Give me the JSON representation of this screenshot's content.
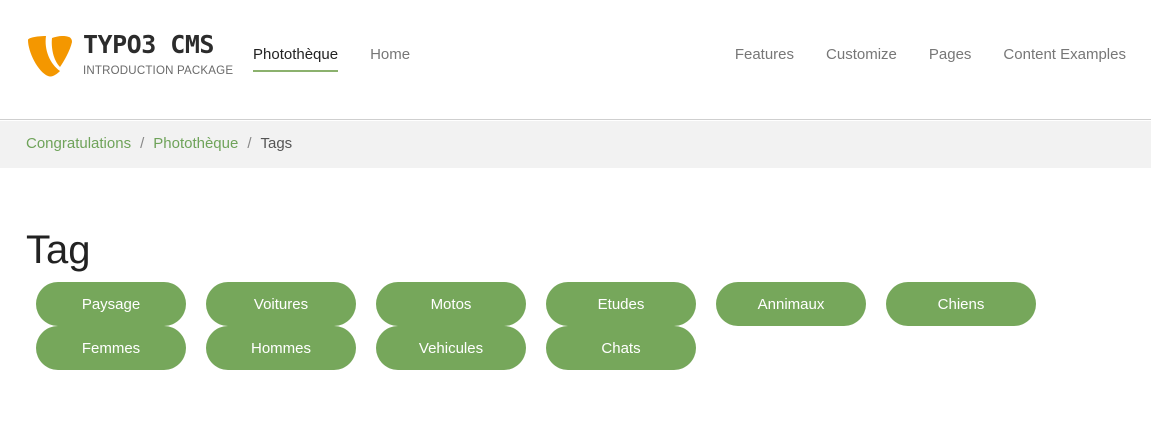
{
  "header": {
    "logo": {
      "title": "TYPO3 CMS",
      "subtitle": "INTRODUCTION PACKAGE",
      "accent": "#f49700"
    },
    "nav_left": [
      {
        "label": "Photothèque",
        "active": true
      },
      {
        "label": "Home",
        "active": false
      }
    ],
    "nav_right": [
      {
        "label": "Features"
      },
      {
        "label": "Customize"
      },
      {
        "label": "Pages"
      },
      {
        "label": "Content Examples"
      }
    ]
  },
  "breadcrumb": {
    "items": [
      "Congratulations",
      "Photothèque"
    ],
    "separator": "/",
    "current": "Tags"
  },
  "main": {
    "title": "Tag",
    "tags": [
      "Paysage",
      "Voitures",
      "Motos",
      "Etudes",
      "Annimaux",
      "Chiens",
      "Femmes",
      "Hommes",
      "Vehicules",
      "Chats"
    ]
  },
  "colors": {
    "accent": "#76a75b",
    "link": "#6fa35a",
    "breadcrumb_bg": "#f2f2f2"
  }
}
